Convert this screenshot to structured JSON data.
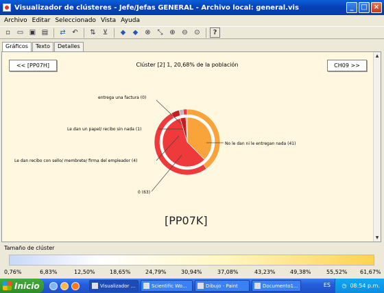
{
  "window": {
    "title": "Visualizador de clústeres - Jefe/Jefas GENERAL - Archivo local: general.vis",
    "minimize_label": "_",
    "maximize_label": "□",
    "close_label": "×"
  },
  "menu": {
    "items": [
      "Archivo",
      "Editar",
      "Seleccionado",
      "Vista",
      "Ayuda"
    ]
  },
  "tabs": [
    "Gráficos",
    "Texto",
    "Detalles"
  ],
  "cluster_view": {
    "prev_button": "<< [PP07H]",
    "next_button": "CH09 >>",
    "heading": "Clúster [2] 1, 20,68% de la población",
    "variable_code": "[PP07K]"
  },
  "chart_data": {
    "type": "pie",
    "title": "",
    "categories": [
      "No le dan ni le entregan nada",
      "0",
      "Le dan recibo con sello/ membrete/ firma del empleador",
      "Le dan un papel/ recibo sin nada",
      "entrega una factura"
    ],
    "slice_labels": [
      "No le dan ni le entregan nada (41)",
      "0 (63)",
      "Le dan recibo con sello/ membrete/ firma del empleador (4)",
      "Le dan un papel/ recibo sin nada (1)",
      "entrega una factura (0)"
    ],
    "series": [
      {
        "values": [
          41,
          63,
          4,
          1,
          0
        ]
      }
    ],
    "outer_ring_percent": [
      40,
      52,
      4,
      2,
      2
    ],
    "colors": {
      "orange": "#f9a43a",
      "red": "#ee3a3a",
      "dark_red": "#c61c1c",
      "grey": "#b8b8b8"
    }
  },
  "size_bar": {
    "title": "Tamaño de clúster",
    "ticks": [
      "0,76%",
      "6,83%",
      "12,50%",
      "18,65%",
      "24,79%",
      "30,94%",
      "37,08%",
      "43,23%",
      "49,38%",
      "55,52%",
      "61,67%"
    ]
  },
  "taskbar": {
    "start_label": "Inicio",
    "tasks": [
      "Visualizador ...",
      "Scientific Wo...",
      "Dibujo - Paint",
      "Documento1..."
    ],
    "language": "ES",
    "clock": "08:54 p.m."
  }
}
